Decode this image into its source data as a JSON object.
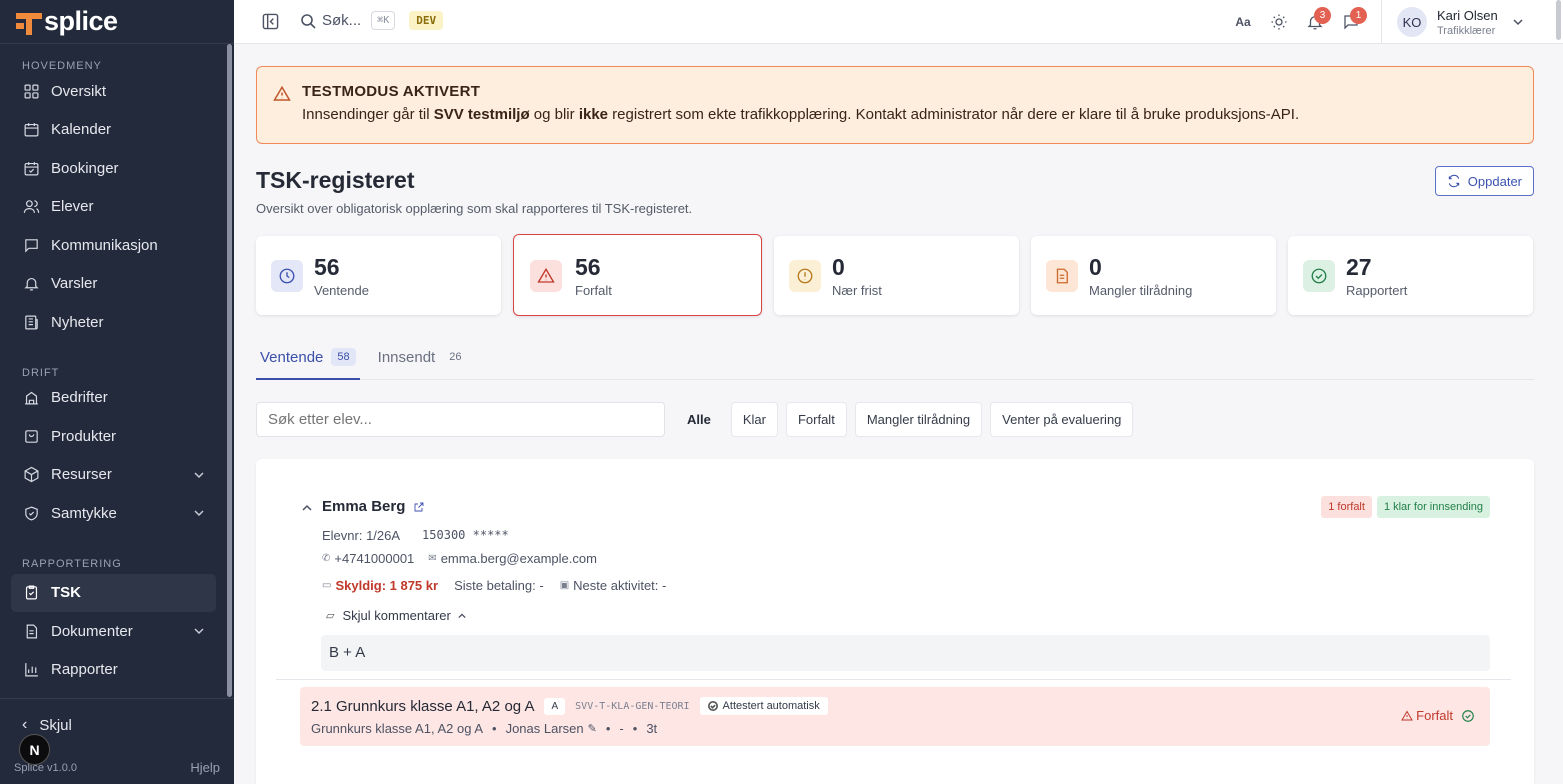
{
  "brand": {
    "name": "splice",
    "accent": "#f08a3c",
    "sidebar_bg": "#232a3b"
  },
  "sidebar": {
    "sections": [
      {
        "title": "HOVEDMENY",
        "items": [
          {
            "label": "Oversikt",
            "icon": "grid-icon"
          },
          {
            "label": "Kalender",
            "icon": "calendar-icon"
          },
          {
            "label": "Bookinger",
            "icon": "calendar-check-icon"
          },
          {
            "label": "Elever",
            "icon": "users-icon"
          },
          {
            "label": "Kommunikasjon",
            "icon": "chat-icon"
          },
          {
            "label": "Varsler",
            "icon": "bell-icon"
          },
          {
            "label": "Nyheter",
            "icon": "newspaper-icon"
          }
        ]
      },
      {
        "title": "DRIFT",
        "items": [
          {
            "label": "Bedrifter",
            "icon": "building-icon"
          },
          {
            "label": "Produkter",
            "icon": "bag-icon"
          },
          {
            "label": "Resurser",
            "icon": "box-icon"
          },
          {
            "label": "Samtykke",
            "icon": "shield-check-icon"
          }
        ]
      },
      {
        "title": "RAPPORTERING",
        "items": [
          {
            "label": "TSK",
            "icon": "clipboard-check-icon"
          },
          {
            "label": "Dokumenter",
            "icon": "document-icon"
          },
          {
            "label": "Rapporter",
            "icon": "bar-chart-icon"
          }
        ]
      }
    ],
    "hide_label": "Skjul",
    "version": "Splice v1.0.0",
    "help": "Hjelp",
    "n_badge": "N"
  },
  "topbar": {
    "search_label": "Søk...",
    "shortcut": "⌘K",
    "env_badge": "DEV",
    "notifications_count": "3",
    "messages_count": "1",
    "user": {
      "initials": "KO",
      "name": "Kari Olsen",
      "role": "Trafikklærer"
    }
  },
  "alert": {
    "title": "TESTMODUS AKTIVERT",
    "body_pre": "Innsendinger går til ",
    "body_b1": "SVV testmiljø",
    "body_mid": " og blir ",
    "body_b2": "ikke",
    "body_post": " registrert som ekte trafikkopplæring. Kontakt administrator når dere er klare til å bruke produksjons-API."
  },
  "page": {
    "title": "TSK-registeret",
    "subtitle": "Oversikt over obligatorisk opplæring som skal rapporteres til TSK-registeret.",
    "refresh_label": "Oppdater"
  },
  "stats": [
    {
      "value": "56",
      "label": "Ventende",
      "color": "#3c52b0"
    },
    {
      "value": "56",
      "label": "Forfalt",
      "color": "#c0392b"
    },
    {
      "value": "0",
      "label": "Nær frist",
      "color": "#b7791f"
    },
    {
      "value": "0",
      "label": "Mangler tilrådning",
      "color": "#d06a2a"
    },
    {
      "value": "27",
      "label": "Rapportert",
      "color": "#24814a"
    }
  ],
  "tabs": [
    {
      "label": "Ventende",
      "count": "58"
    },
    {
      "label": "Innsendt",
      "count": "26"
    }
  ],
  "filters": {
    "search_placeholder": "Søk etter elev...",
    "buttons": [
      "Alle",
      "Klar",
      "Forfalt",
      "Mangler tilrådning",
      "Venter på evaluering"
    ]
  },
  "student": {
    "name": "Emma Berg",
    "badge_overdue": "1 forfalt",
    "badge_ready": "1 klar for innsending",
    "elevnr": "Elevnr: 1/26A",
    "ssn": "150300 *****",
    "phone": "+4741000001",
    "email": "emma.berg@example.com",
    "owes": "Skyldig: 1 875 kr",
    "last_payment": "Siste betaling: -",
    "next_activity": "Neste aktivitet: -",
    "comments_toggle": "Skjul kommentarer",
    "comment": "B + A"
  },
  "course": {
    "title": "2.1 Grunnkurs klasse A1, A2 og A",
    "class_badge": "A",
    "code": "SVV-T-KLA-GEN-TEORI",
    "attest": "Attestert automatisk",
    "sub_name": "Grunnkurs klasse A1, A2 og A",
    "instructor": "Jonas Larsen",
    "dash": "-",
    "hours": "3t",
    "status": "Forfalt"
  }
}
